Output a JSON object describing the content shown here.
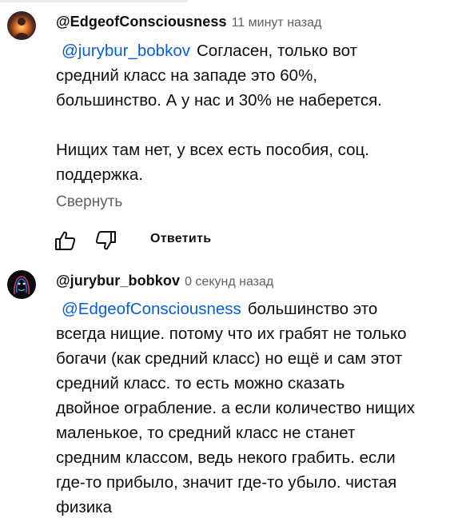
{
  "comments": [
    {
      "author": "@EdgeofConsciousness",
      "time": "11 минут назад",
      "mention": "@jurybur_bobkov",
      "first_line_rest": "Согласен, только вот",
      "lines": [
        "средний класс на западе это 60%,",
        "большинство. А у нас и 30% не наберется."
      ],
      "paragraph2": [
        "Нищих там нет, у всех есть пособия, соц.",
        "поддержка."
      ],
      "collapse_label": "Свернуть",
      "like_icon": "thumbs-up-icon",
      "dislike_icon": "thumbs-down-icon",
      "reply_label": "Ответить"
    },
    {
      "author": "@jurybur_bobkov",
      "time": "0 секунд назад",
      "mention": "@EdgeofConsciousness",
      "first_line_rest": "большинство это",
      "lines": [
        "всегда нищие. потому что их грабят не только",
        "богачи (как средний класс) но ещё и сам этот",
        "средний класс. то есть можно сказать",
        "двойное ограбление. а если количество нищих",
        "маленькое, то средний класс не станет",
        "средним классом, ведь некого грабить. если",
        "где-то прибыло, значит где-то убыло. чистая",
        "физика"
      ]
    }
  ],
  "colors": {
    "text": "#0f0f0f",
    "secondary": "#606060",
    "link": "#065fd4"
  }
}
